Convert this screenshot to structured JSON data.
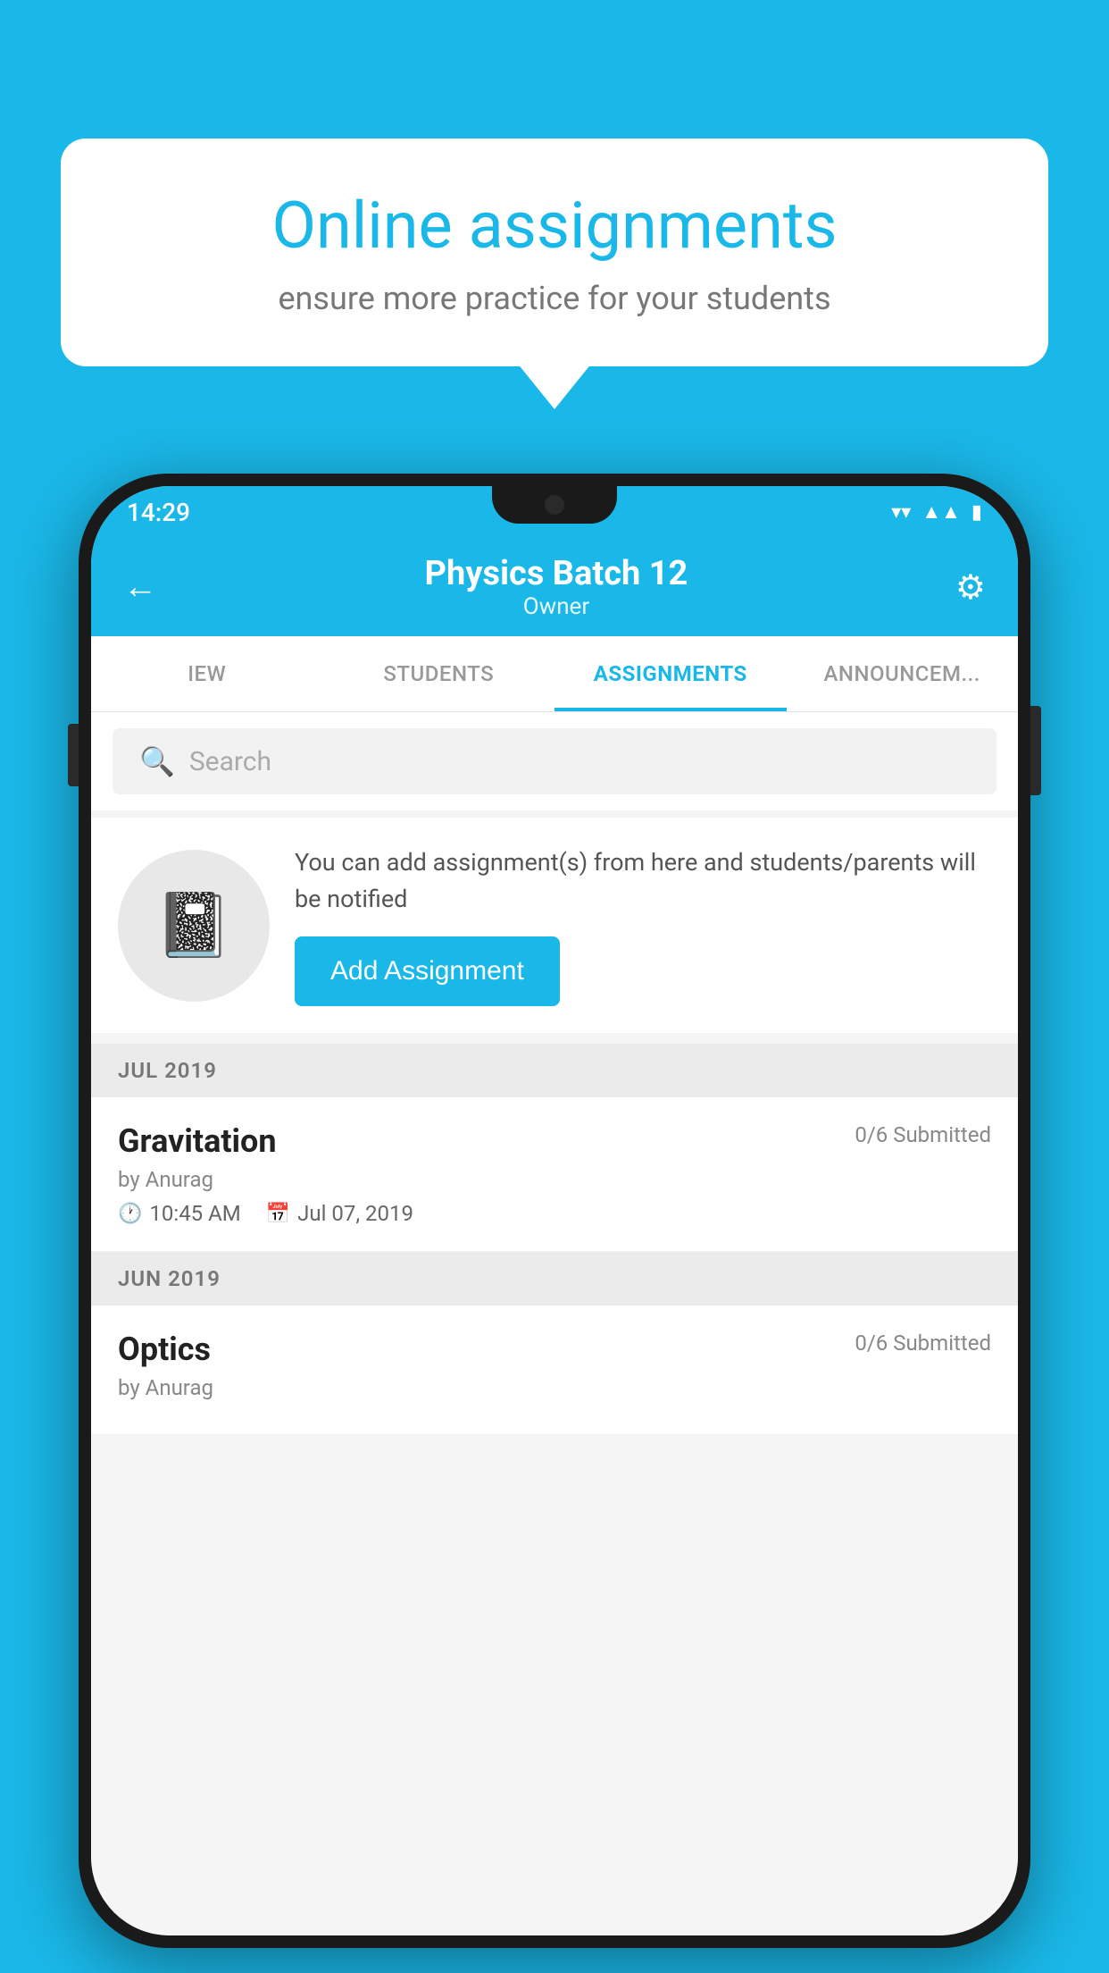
{
  "background_color": "#1ab8e8",
  "speech_bubble": {
    "title": "Online assignments",
    "subtitle": "ensure more practice for your students"
  },
  "status_bar": {
    "time": "14:29",
    "icons": [
      "wifi",
      "signal",
      "battery"
    ]
  },
  "app_header": {
    "title": "Physics Batch 12",
    "subtitle": "Owner",
    "back_label": "←",
    "settings_label": "⚙"
  },
  "tabs": [
    {
      "label": "IEW",
      "active": false
    },
    {
      "label": "STUDENTS",
      "active": false
    },
    {
      "label": "ASSIGNMENTS",
      "active": true
    },
    {
      "label": "ANNOUNCEM...",
      "active": false
    }
  ],
  "search": {
    "placeholder": "Search"
  },
  "promo": {
    "text": "You can add assignment(s) from here and students/parents will be notified",
    "button_label": "Add Assignment"
  },
  "sections": [
    {
      "header": "JUL 2019",
      "assignments": [
        {
          "name": "Gravitation",
          "submitted": "0/6 Submitted",
          "by": "by Anurag",
          "time": "10:45 AM",
          "date": "Jul 07, 2019"
        }
      ]
    },
    {
      "header": "JUN 2019",
      "assignments": [
        {
          "name": "Optics",
          "submitted": "0/6 Submitted",
          "by": "by Anurag",
          "time": "",
          "date": ""
        }
      ]
    }
  ]
}
